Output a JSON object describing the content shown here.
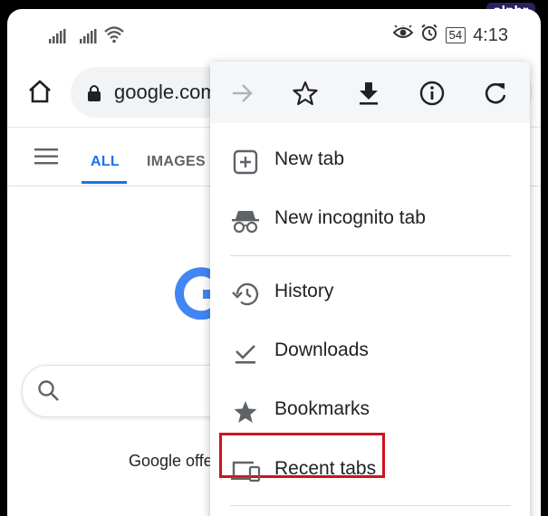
{
  "watermark": "alphr",
  "status_bar": {
    "icons": [
      "signal-icon",
      "signal-icon",
      "wifi-icon",
      "eye-comfort-icon",
      "alarm-icon",
      "battery-icon"
    ],
    "battery": "54",
    "time": "4:13"
  },
  "toolbar": {
    "home_icon": "home-icon",
    "lock_icon": "lock-icon",
    "url": "google.com"
  },
  "search_tabs": {
    "all": "ALL",
    "images": "IMAGES"
  },
  "page": {
    "offered_text": "Google offe"
  },
  "menu": {
    "top_icons": [
      "forward-icon",
      "star-outline-icon",
      "download-icon",
      "info-icon",
      "refresh-icon"
    ],
    "items": [
      {
        "label": "New tab",
        "icon": "new-tab-icon"
      },
      {
        "label": "New incognito tab",
        "icon": "incognito-icon"
      },
      {
        "label": "History",
        "icon": "history-icon"
      },
      {
        "label": "Downloads",
        "icon": "downloads-icon"
      },
      {
        "label": "Bookmarks",
        "icon": "star-icon"
      },
      {
        "label": "Recent tabs",
        "icon": "devices-icon"
      }
    ]
  },
  "colors": {
    "accent": "#1a73e8",
    "highlight": "#d0121b",
    "text": "#202124"
  }
}
